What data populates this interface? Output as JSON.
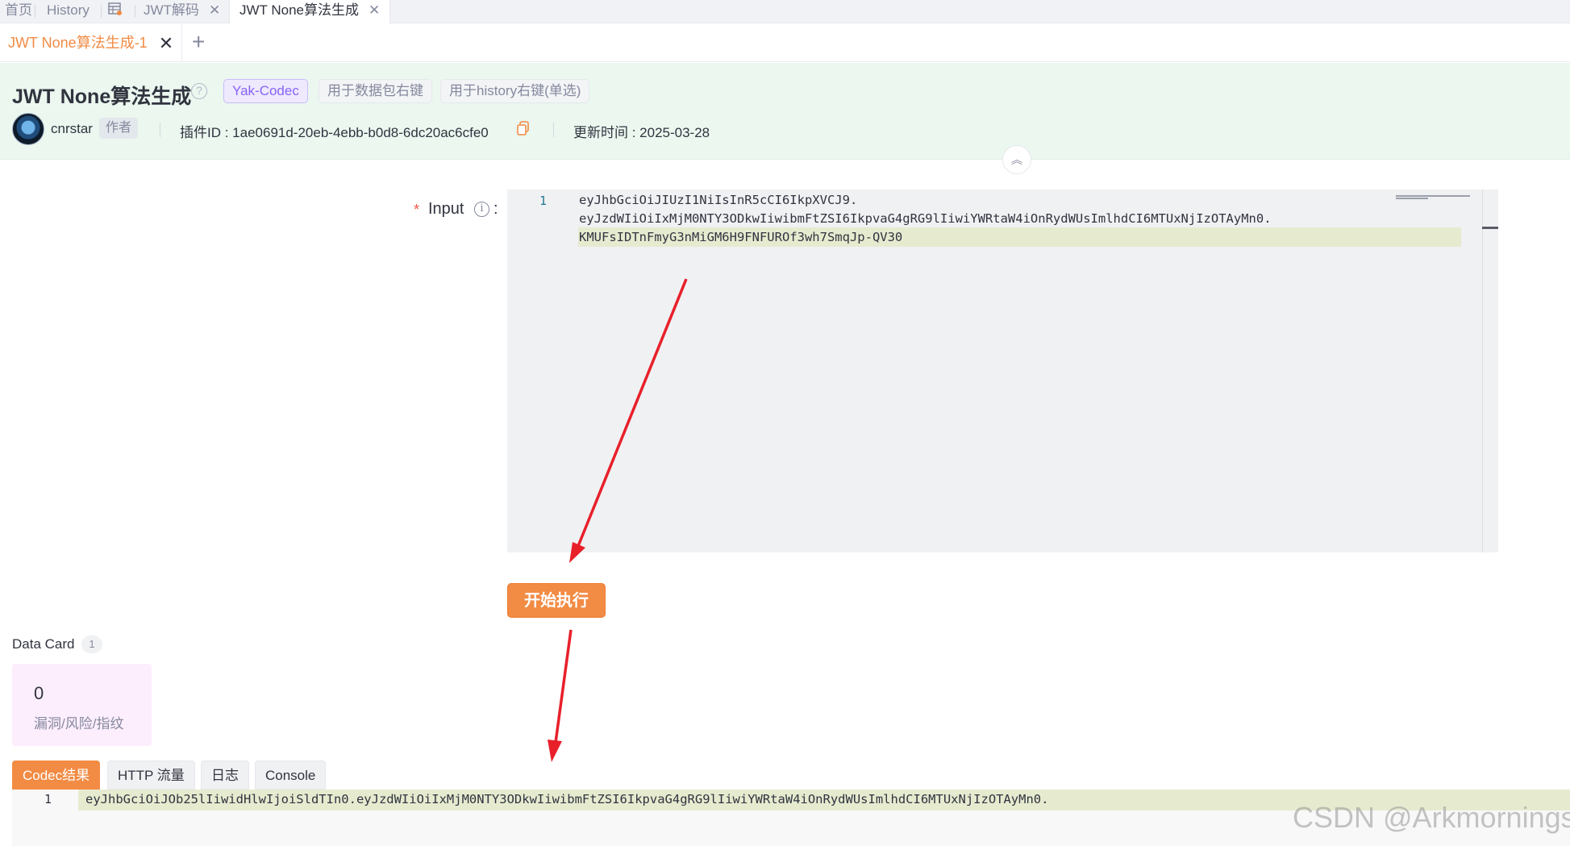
{
  "top_tabs": {
    "home": "首页",
    "history": "History",
    "jwt_decode": "JWT解码",
    "jwt_none": "JWT None算法生成"
  },
  "sub_tabs": {
    "active": "JWT None算法生成-1"
  },
  "plugin": {
    "title": "JWT None算法生成",
    "tags": [
      "Yak-Codec",
      "用于数据包右键",
      "用于history右键(单选)"
    ],
    "author": "cnrstar",
    "author_tag": "作者",
    "plugin_id": "插件ID : 1ae0691d-20eb-4ebb-b0d8-6dc20ac6cfe0",
    "updated": "更新时间 : 2025-03-28"
  },
  "form": {
    "input_label": "Input",
    "required_mark": "*",
    "colon": ":",
    "editor": {
      "line_number": "1",
      "lines": [
        "eyJhbGciOiJIUzI1NiIsInR5cCI6IkpXVCJ9.",
        "eyJzdWIiOiIxMjM0NTY3ODkwIiwibmFtZSI6IkpvaG4gRG9lIiwiYWRtaW4iOnRydWUsImlhdCI6MTUxNjIzOTAyMn0.",
        "KMUFsIDTnFmyG3nMiGM6H9FNFUROf3wh7SmqJp-QV30"
      ]
    },
    "run_button": "开始执行"
  },
  "data_card": {
    "title": "Data Card",
    "count": "1",
    "value": "0",
    "label": "漏洞/风险/指纹"
  },
  "result_tabs": [
    "Codec结果",
    "HTTP 流量",
    "日志",
    "Console"
  ],
  "result": {
    "line_number": "1",
    "text": "eyJhbGciOiJOb25lIiwidHlwIjoiSldTIn0.eyJzdWIiOiIxMjM0NTY3ODkwIiwibmFtZSI6IkpvaG4gRG9lIiwiYWRtaW4iOnRydWUsImlhdCI6MTUxNjIzOTAyMn0."
  },
  "watermark": "CSDN @Arkmornings",
  "colors": {
    "accent": "#f28b44",
    "header_bg": "#ebf7ef",
    "arrow": "#e8202a"
  }
}
